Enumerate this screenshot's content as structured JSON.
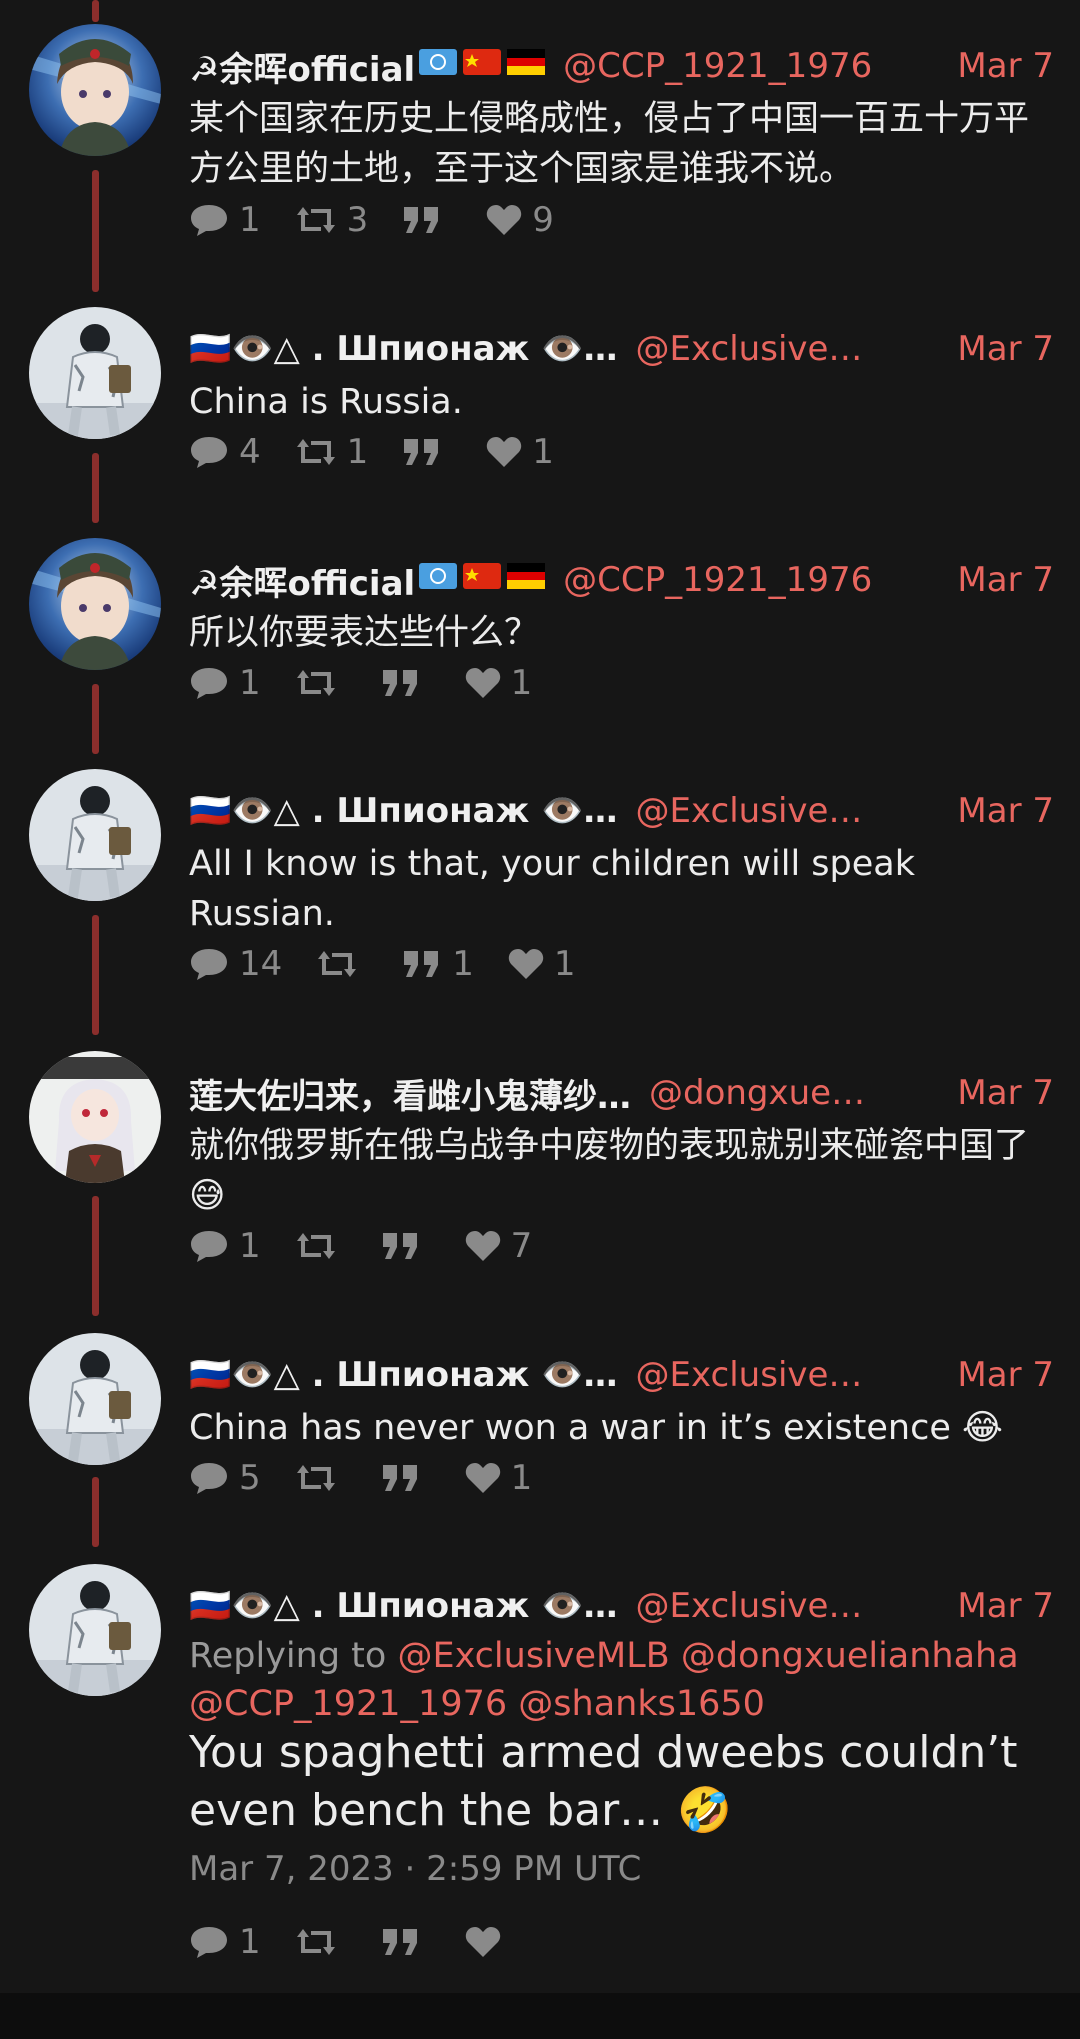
{
  "tweets": [
    {
      "name": "☭余晖official",
      "handle": "@CCP_1921_1976",
      "date": "Mar 7",
      "text": "某个国家在历史上侵略成性，侵占了中国一百五十万平方公里的土地，至于这个国家是谁我不说。",
      "replies": "1",
      "retweets": "3",
      "quotes": "",
      "likes": "9"
    },
    {
      "name": "🇷🇺👁️△ . Шпионаж 👁️…",
      "handle": "@Exclusive…",
      "date": "Mar 7",
      "text": "China is Russia.",
      "replies": "4",
      "retweets": "1",
      "quotes": "",
      "likes": "1"
    },
    {
      "name": "☭余晖official",
      "handle": "@CCP_1921_1976",
      "date": "Mar 7",
      "text": "所以你要表达些什么？",
      "replies": "1",
      "retweets": "",
      "quotes": "",
      "likes": "1"
    },
    {
      "name": "🇷🇺👁️△ . Шпионаж 👁️…",
      "handle": "@Exclusive…",
      "date": "Mar 7",
      "text": "All I know is that, your children will speak Russian.",
      "replies": "14",
      "retweets": "",
      "quotes": "1",
      "likes": "1"
    },
    {
      "name": "莲大佐归来，看雌小鬼薄纱…",
      "handle": "@dongxue…",
      "date": "Mar 7",
      "text": "就你俄罗斯在俄乌战争中废物的表现就别来碰瓷中国了😅",
      "replies": "1",
      "retweets": "",
      "quotes": "",
      "likes": "7"
    },
    {
      "name": "🇷🇺👁️△ . Шпионаж 👁️…",
      "handle": "@Exclusive…",
      "date": "Mar 7",
      "text": "China has never won a war in it’s existence 😂",
      "replies": "5",
      "retweets": "",
      "quotes": "",
      "likes": "1"
    },
    {
      "name": "🇷🇺👁️△ . Шпионаж 👁️…",
      "handle": "@Exclusive…",
      "date": "Mar 7",
      "replying_label": "Replying to",
      "mentions": [
        "@ExclusiveMLB",
        "@dongxuelianhaha",
        "@CCP_1921_1976",
        "@shanks1650"
      ],
      "text": "You spaghetti armed dweebs couldn’t even bench the bar… 🤣",
      "timestamp": "Mar 7, 2023 · 2:59 PM UTC",
      "replies": "1",
      "retweets": "",
      "quotes": "",
      "likes": ""
    }
  ],
  "colors": {
    "background": "#161616",
    "accent": "#e8665f",
    "thread_line": "#8b2e2c",
    "muted": "#8a8a8a"
  },
  "icons": {
    "reply": "reply-icon",
    "retweet": "retweet-icon",
    "quote": "quote-icon",
    "like": "heart-icon"
  }
}
